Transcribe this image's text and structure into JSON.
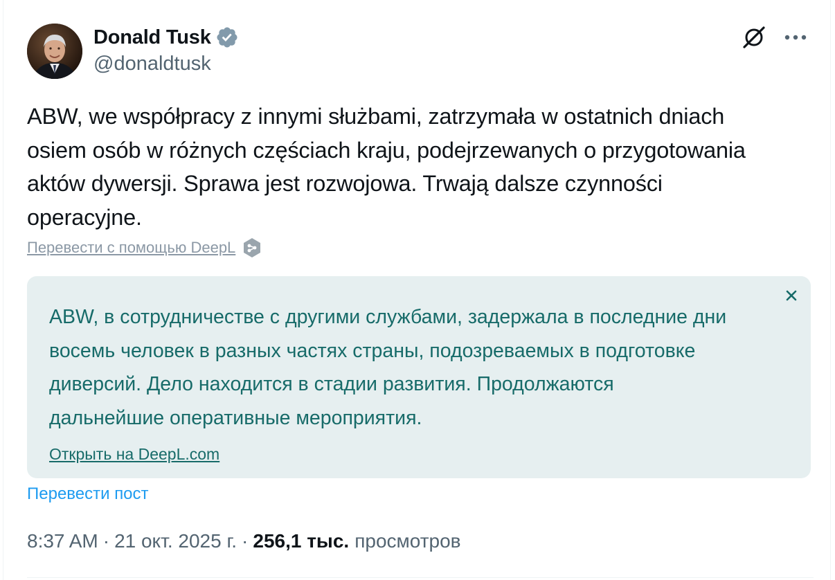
{
  "author": {
    "display_name": "Donald Tusk",
    "handle": "@donaldtusk",
    "verified_color": "#829aab"
  },
  "post": {
    "text": "ABW, we współpracy z innymi służbami, zatrzymała w ostatnich dniach\nosiem osób w różnych częściach kraju, podejrzewanych o przygotowania\naktów dywersji. Sprawa jest rozwojowa. Trwają dalsze czynności\noperacyjne."
  },
  "deepl": {
    "translate_link": "Перевести с помощью DeepL",
    "translation": "ABW, в сотрудничестве с другими службами, задержала в последние дни\nвосемь человек в разных частях страны, подозреваемых в подготовке\nдиверсий. Дело находится в стадии развития. Продолжаются\nдальнейшие оперативные мероприятия.",
    "open_link": "Открыть на DeepL.com",
    "box_color": "#e6eff0",
    "text_color": "#176b69"
  },
  "actions": {
    "translate_post": "Перевести пост"
  },
  "meta": {
    "time": "8:37 AM",
    "separator": "·",
    "date": "21 окт. 2025 г.",
    "views_count": "256,1 тыс.",
    "views_label": "просмотров"
  },
  "icons": {
    "grok": "grok-icon",
    "more": "more-options-icon",
    "close": "close-icon",
    "deepl": "deepl-logo-icon",
    "verified": "verified-badge-icon"
  }
}
